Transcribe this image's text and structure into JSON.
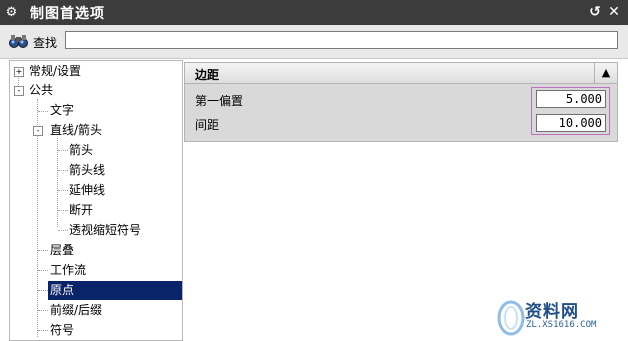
{
  "window": {
    "title": "制图首选项",
    "icons": {
      "app": "gear-icon",
      "reset": "reset-icon",
      "close": "close-icon"
    }
  },
  "search": {
    "label": "查找",
    "value": "",
    "icon": "binoculars-icon"
  },
  "tree": {
    "items": [
      {
        "label": "常规/设置",
        "level": 0,
        "expander": "+"
      },
      {
        "label": "公共",
        "level": 0,
        "expander": "-"
      },
      {
        "label": "文字",
        "level": 1
      },
      {
        "label": "直线/箭头",
        "level": 1,
        "expander": "-"
      },
      {
        "label": "箭头",
        "level": 2
      },
      {
        "label": "箭头线",
        "level": 2
      },
      {
        "label": "延伸线",
        "level": 2
      },
      {
        "label": "断开",
        "level": 2
      },
      {
        "label": "透视缩短符号",
        "level": 2
      },
      {
        "label": "层叠",
        "level": 1
      },
      {
        "label": "工作流",
        "level": 1
      },
      {
        "label": "原点",
        "level": 1,
        "selected": true
      },
      {
        "label": "前缀/后缀",
        "level": 1
      },
      {
        "label": "符号",
        "level": 1
      }
    ]
  },
  "section": {
    "title": "边距",
    "collapse_icon": "chevron-up-icon",
    "fields": [
      {
        "label": "第一偏置",
        "value": "5.000"
      },
      {
        "label": "间距",
        "value": "10.000"
      }
    ]
  },
  "watermark": {
    "name": "资料网",
    "url": "ZL.XS1616.COM"
  },
  "colors": {
    "titlebar": "#3c3c3c",
    "selection": "#0a246a",
    "highlight_box": "#c070c0",
    "section_bg": "#d9d9d9"
  }
}
